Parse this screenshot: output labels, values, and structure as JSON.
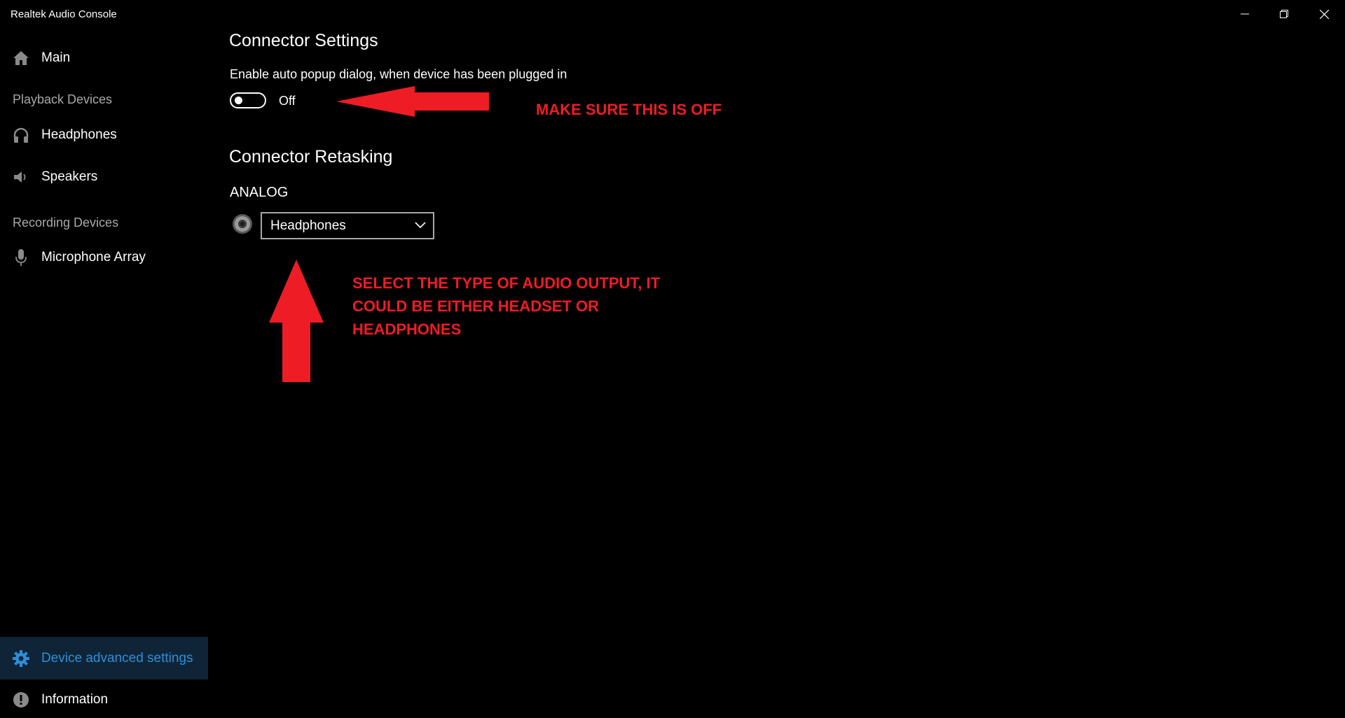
{
  "window": {
    "title": "Realtek Audio Console",
    "controls": [
      "minimize-icon",
      "restore-icon",
      "close-icon"
    ]
  },
  "sidebar": {
    "main_label": "Main",
    "playback_section": "Playback Devices",
    "playback_items": [
      "Headphones",
      "Speakers"
    ],
    "recording_section": "Recording Devices",
    "recording_items": [
      "Microphone Array"
    ],
    "bottom_items": [
      "Device advanced settings",
      "Information"
    ],
    "active_item": "Device advanced settings"
  },
  "main": {
    "connector_settings": {
      "heading": "Connector Settings",
      "description": "Enable auto popup dialog, when device has been plugged in",
      "toggle_state": "Off"
    },
    "connector_retasking": {
      "heading": "Connector Retasking",
      "group_label": "ANALOG",
      "dropdown_value": "Headphones"
    }
  },
  "annotations": {
    "toggle_note": "MAKE SURE THIS IS OFF",
    "dropdown_note_lines": [
      "SELECT THE TYPE OF AUDIO OUTPUT, IT",
      "COULD BE EITHER HEADSET OR",
      "HEADPHONES"
    ]
  },
  "colors": {
    "background": "#000000",
    "accent": "#2e8ed8",
    "active_bg": "#0f2537",
    "annotation": "#ee1c25",
    "section_text": "#a8a8a8"
  }
}
